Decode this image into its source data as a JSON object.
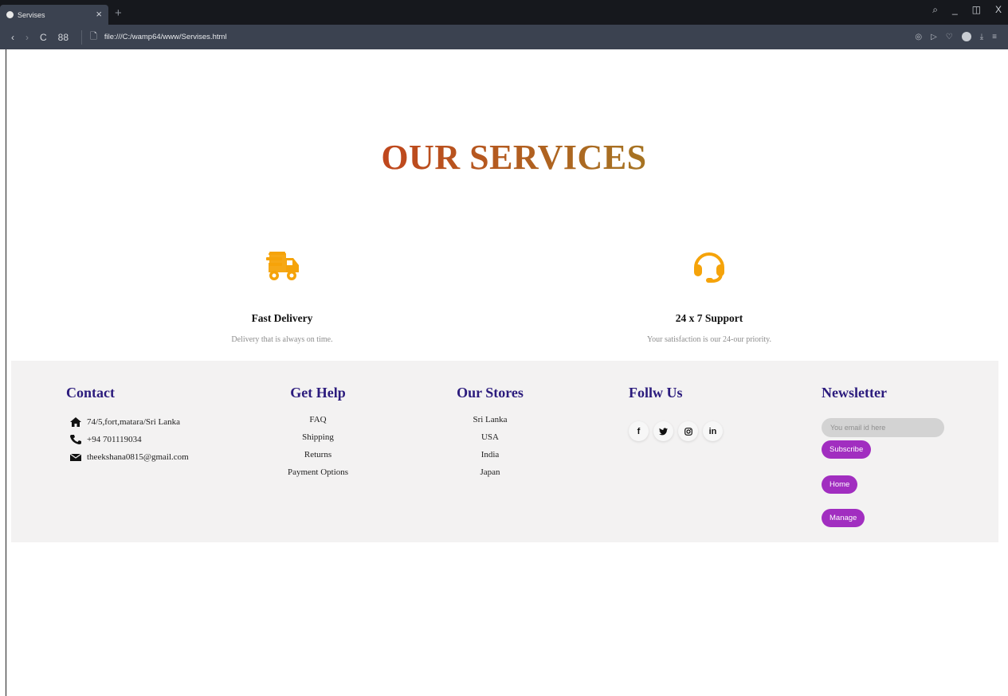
{
  "browser": {
    "tab_title": "Servises",
    "tab_close": "×",
    "new_tab": "+",
    "url": "file:///C:/wamp64/www/Servises.html",
    "nav": {
      "back": "‹",
      "forward": "›",
      "reload": "C",
      "speed_dial": "88"
    },
    "window_controls": {
      "search": "⌕",
      "minimize": "_",
      "restore": "◫",
      "close": "X"
    },
    "toolbar_icons": {
      "snapshot": "◎",
      "player": "▷",
      "wishlist": "♡",
      "downloads": "⤓",
      "menu": "≡"
    }
  },
  "hero": {
    "title": "OUR SERVICES"
  },
  "services": [
    {
      "icon": "delivery-truck-icon",
      "title": "Fast Delivery",
      "description": "Delivery that is always on time."
    },
    {
      "icon": "headset-icon",
      "title": "24 x 7 Support",
      "description": "Your satisfaction is our 24-our priority."
    }
  ],
  "footer": {
    "contact": {
      "heading": "Contact",
      "address": "74/5,fort,matara/Sri Lanka",
      "phone": "+94 701119034",
      "email": "theekshana0815@gmail.com"
    },
    "help": {
      "heading": "Get Help",
      "links": [
        "FAQ",
        "Shipping",
        "Returns",
        "Payment Options"
      ]
    },
    "stores": {
      "heading": "Our Stores",
      "links": [
        "Sri Lanka",
        "USA",
        "India",
        "Japan"
      ]
    },
    "follow": {
      "heading": "Follw Us",
      "links": [
        {
          "icon": "facebook-icon",
          "glyph": "f"
        },
        {
          "icon": "twitter-icon",
          "glyph": "🐦"
        },
        {
          "icon": "instagram-icon",
          "glyph": "◎"
        },
        {
          "icon": "linkedin-icon",
          "glyph": "in"
        }
      ]
    },
    "newsletter": {
      "heading": "Newsletter",
      "email_placeholder": "You email id here",
      "subscribe_label": "Subscribe",
      "home_label": "Home",
      "manage_label": "Manage"
    }
  },
  "colors": {
    "accent_orange": "#f5a30a",
    "heading_navy": "#2b1b7d",
    "button_purple": "#a12ec0",
    "footer_bg": "#f3f2f2"
  }
}
